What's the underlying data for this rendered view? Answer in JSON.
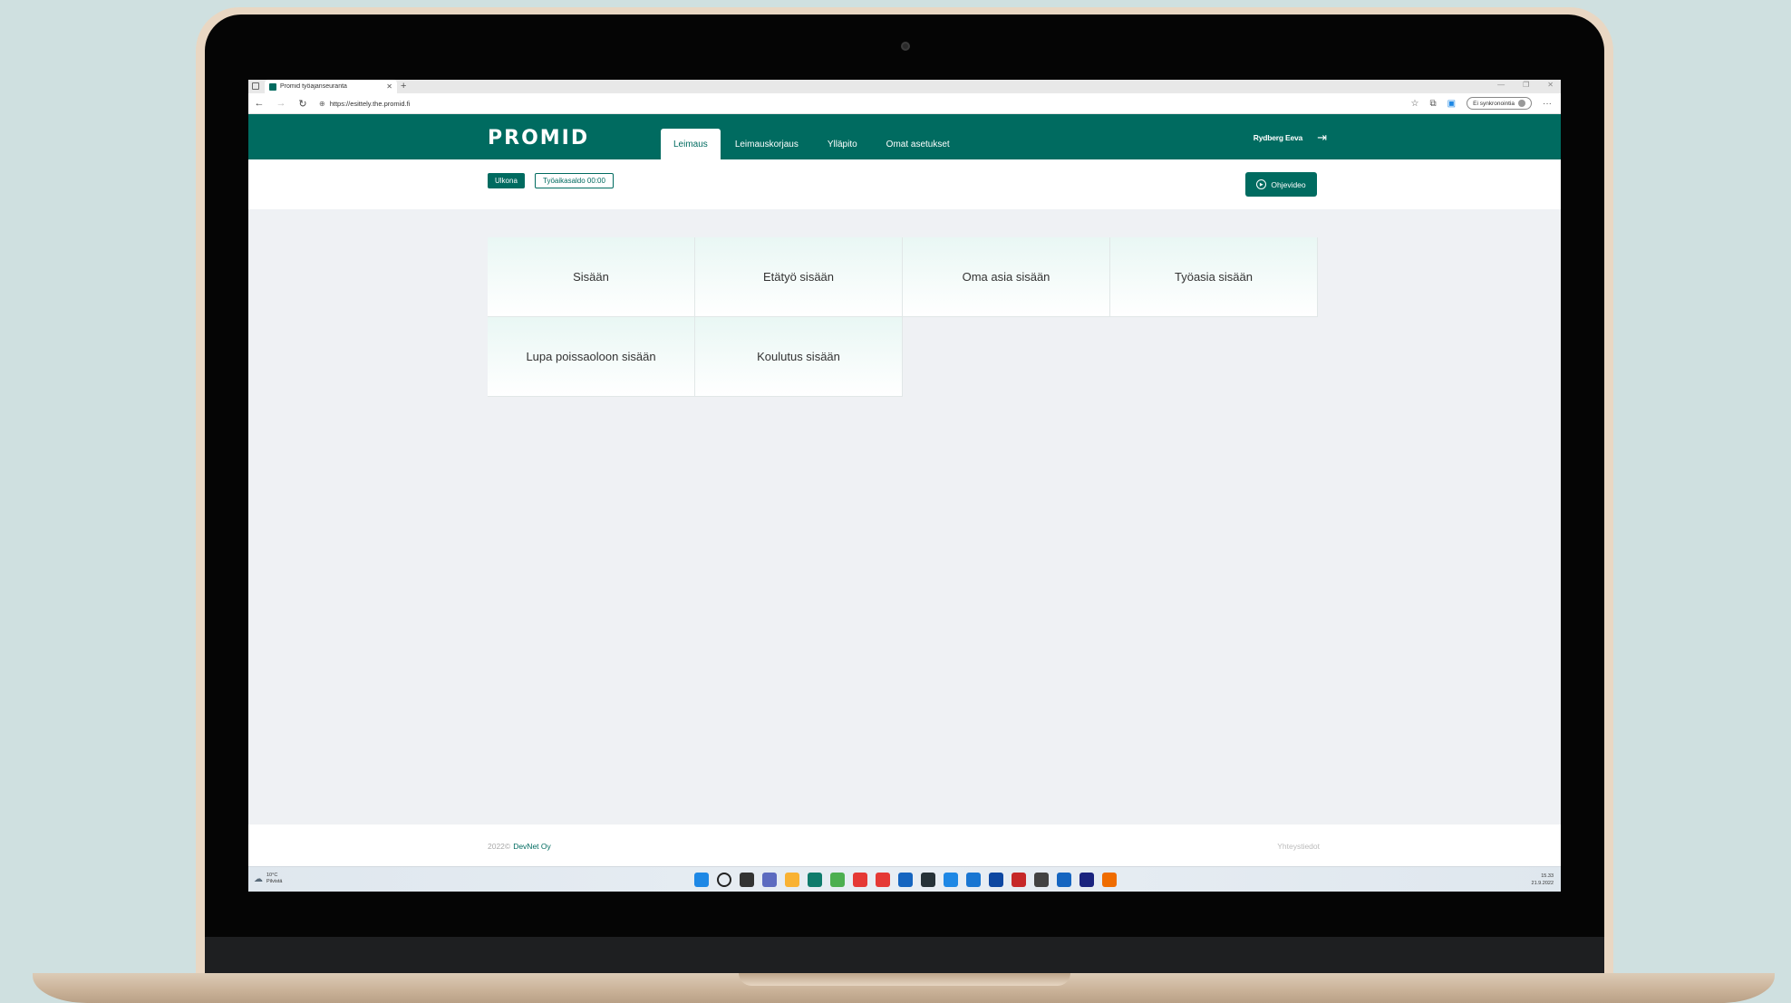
{
  "browser": {
    "tab_title": "Promid työajanseuranta",
    "url": "https://esittely.the.promid.fi",
    "sync_label": "Ei synkronointia"
  },
  "app": {
    "logo": "PROMID",
    "nav": [
      "Leimaus",
      "Leimauskorjaus",
      "Ylläpito",
      "Omat asetukset"
    ],
    "user_name": "Rydberg Eeva"
  },
  "status": {
    "presence": "Ulkona",
    "balance": "Työaikasaldo 00:00",
    "video_button": "Ohjevideo"
  },
  "tiles": [
    "Sisään",
    "Etätyö sisään",
    "Oma asia sisään",
    "Työasia sisään",
    "Lupa poissaoloon sisään",
    "Koulutus sisään"
  ],
  "footer": {
    "year": "2022©",
    "company": "DevNet Oy",
    "contact": "Yhteystiedot"
  },
  "taskbar": {
    "temp": "10°C",
    "weather": "Pilvistä",
    "time": "15.33",
    "date": "21.9.2022",
    "icon_colors": [
      "#1e88e5",
      "#222222",
      "#333333",
      "#5c6bc0",
      "#f9b233",
      "#0f7b6c",
      "#4caf50",
      "#e53935",
      "#e53935",
      "#1565c0",
      "#263238",
      "#1e88e5",
      "#1976d2",
      "#0d47a1",
      "#c62828",
      "#424242",
      "#1565c0",
      "#1a237e",
      "#ef6c00"
    ]
  },
  "colors": {
    "brand": "#006b60"
  }
}
